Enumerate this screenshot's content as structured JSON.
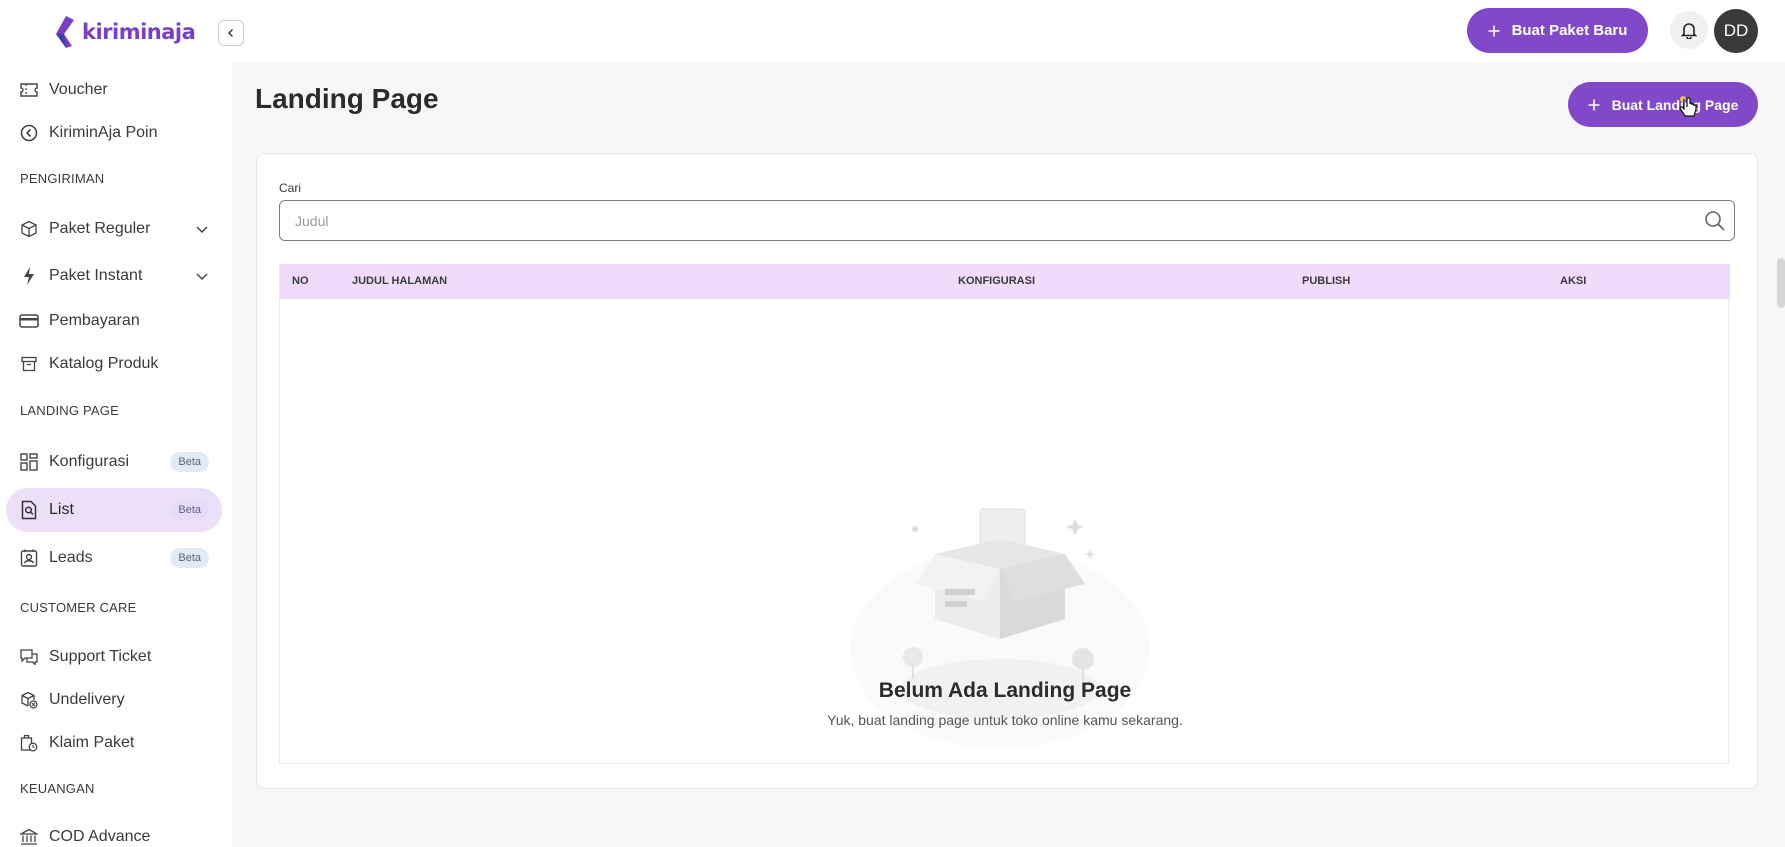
{
  "brand": {
    "name": "kiriminaja",
    "accent": "#8149c9"
  },
  "topbar": {
    "new_package_label": "Buat Paket Baru",
    "avatar_initials": "DD"
  },
  "sidebar": {
    "items_top": [
      {
        "label": "Voucher",
        "icon": "ticket-icon"
      },
      {
        "label": "KiriminAja Poin",
        "icon": "coin-icon"
      }
    ],
    "section_shipping": "PENGIRIMAN",
    "shipping": [
      {
        "label": "Paket Reguler",
        "icon": "box-icon"
      },
      {
        "label": "Paket Instant",
        "icon": "bolt-icon"
      },
      {
        "label": "Pembayaran",
        "icon": "card-icon"
      },
      {
        "label": "Katalog Produk",
        "icon": "archive-icon"
      }
    ],
    "section_landing": "LANDING PAGE",
    "landing": [
      {
        "label": "Konfigurasi",
        "badge": "Beta"
      },
      {
        "label": "List",
        "badge": "Beta"
      },
      {
        "label": "Leads",
        "badge": "Beta"
      }
    ],
    "section_care": "CUSTOMER CARE",
    "care": [
      {
        "label": "Support Ticket"
      },
      {
        "label": "Undelivery"
      },
      {
        "label": "Klaim Paket"
      }
    ],
    "section_finance": "KEUANGAN",
    "finance": [
      {
        "label": "COD Advance"
      }
    ]
  },
  "page": {
    "title": "Landing Page",
    "create_button": "Buat Landing Page",
    "search_label": "Cari",
    "search_placeholder": "Judul",
    "columns": [
      "NO",
      "JUDUL HALAMAN",
      "KONFIGURASI",
      "PUBLISH",
      "AKSI"
    ],
    "empty_title": "Belum Ada Landing Page",
    "empty_subtitle": "Yuk, buat landing page untuk toko online kamu sekarang."
  }
}
